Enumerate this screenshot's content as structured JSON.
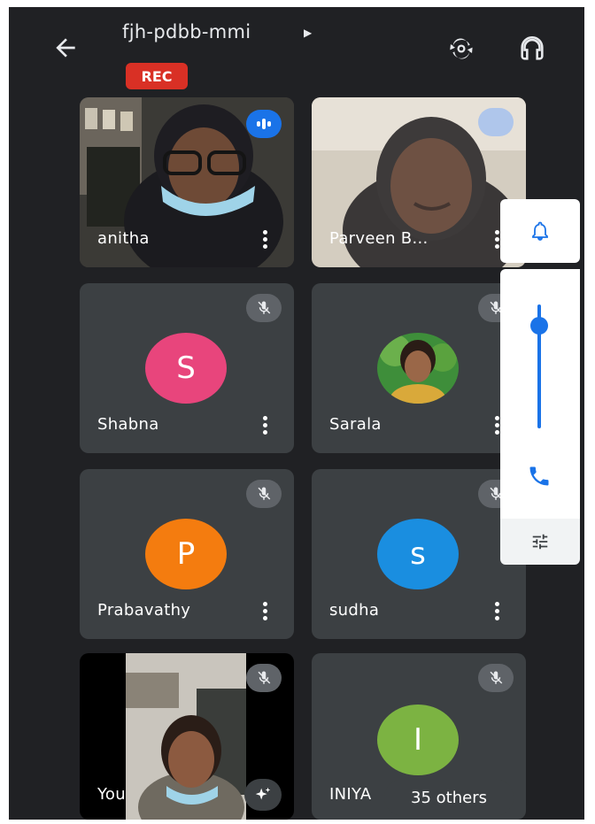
{
  "meeting": {
    "code": "fjh-pdbb-mmi",
    "recording_badge": "REC"
  },
  "participants": [
    {
      "name": "anitha",
      "video": true,
      "speaking": true
    },
    {
      "name": "Parveen B...",
      "video": true
    },
    {
      "name": "Shabna",
      "initial": "S",
      "avatar_color": "#e8457c",
      "muted": true
    },
    {
      "name": "Sarala",
      "photo": true,
      "muted": true
    },
    {
      "name": "Prabavathy",
      "initial": "P",
      "avatar_color": "#f47c0f",
      "muted": true
    },
    {
      "name": "sudha",
      "initial": "s",
      "avatar_color": "#1a8ee0",
      "muted": true
    },
    {
      "name": "You",
      "video": true,
      "muted": true,
      "self": true
    },
    {
      "name": "INIYA",
      "initial": "I",
      "avatar_color": "#7cb342",
      "muted": true
    }
  ],
  "others_chip": "35 others",
  "icons": {
    "back": "arrow-left-icon",
    "switch_camera": "switch-camera-icon",
    "audio": "headset-icon",
    "notify": "bell-icon",
    "call": "phone-icon",
    "settings": "tune-icon",
    "effects": "sparkle-icon"
  },
  "volume_level": 0.85,
  "colors": {
    "background": "#202124",
    "tile": "#3c4043",
    "rec": "#d93025",
    "accent": "#1a73e8"
  }
}
